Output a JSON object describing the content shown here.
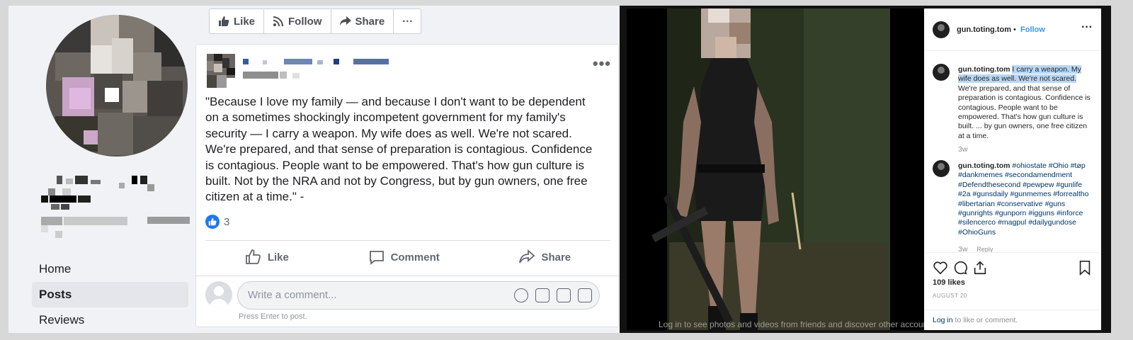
{
  "facebook": {
    "toolbar": {
      "like": "Like",
      "follow": "Follow",
      "share": "Share",
      "more": "···"
    },
    "sidebar": {
      "items": [
        {
          "label": "Home"
        },
        {
          "label": "Posts"
        },
        {
          "label": "Reviews"
        }
      ]
    },
    "post": {
      "more": "•••",
      "text": "\"Because I love my family — and because I don't want to be dependent on a sometimes shockingly incompetent government for my family's security — I carry a weapon. My wife does as well. We're not scared. We're prepared, and that sense of preparation is contagious. Confidence is contagious. People want to be empowered. That's how gun culture is built. Not by the NRA and not by Congress, but by gun owners, one free citizen at a time.\" -",
      "reaction_count": "3",
      "actions": {
        "like": "Like",
        "comment": "Comment",
        "share": "Share"
      },
      "comment_placeholder": "Write a comment...",
      "press_enter": "Press Enter to post."
    }
  },
  "instagram": {
    "username": "gun.toting.tom",
    "separator": "•",
    "follow": "Follow",
    "more": "···",
    "caption": {
      "user": "gun.toting.tom",
      "highlighted": "I carry a weapon. My wife does as well. We're not scared.",
      "rest": " We're prepared, and that sense of preparation is contagious. Confidence is contagious. People want to be empowered. That's how gun culture is built. ... by gun owners, one free citizen at a time.",
      "time": "3w"
    },
    "comment": {
      "user": "gun.toting.tom",
      "tags": "#ohiostate #Ohio #tøp #dankmemes #secondamendment #Defendthesecond #pewpew #gunlife #2a #gunsdaily #gunmemes #forrealtho #libertarian #conservative #guns #gunrights #gunporn #igguns #inforce #silencerco #magpul #dailygundose #OhioGuns",
      "time": "3w",
      "reply": "Reply"
    },
    "likes": "109 likes",
    "date": "AUGUST 20",
    "login_link": "Log in",
    "login_rest": " to like or comment.",
    "footer_text": "Log in to see photos and videos from friends and discover other accounts you'll love."
  }
}
